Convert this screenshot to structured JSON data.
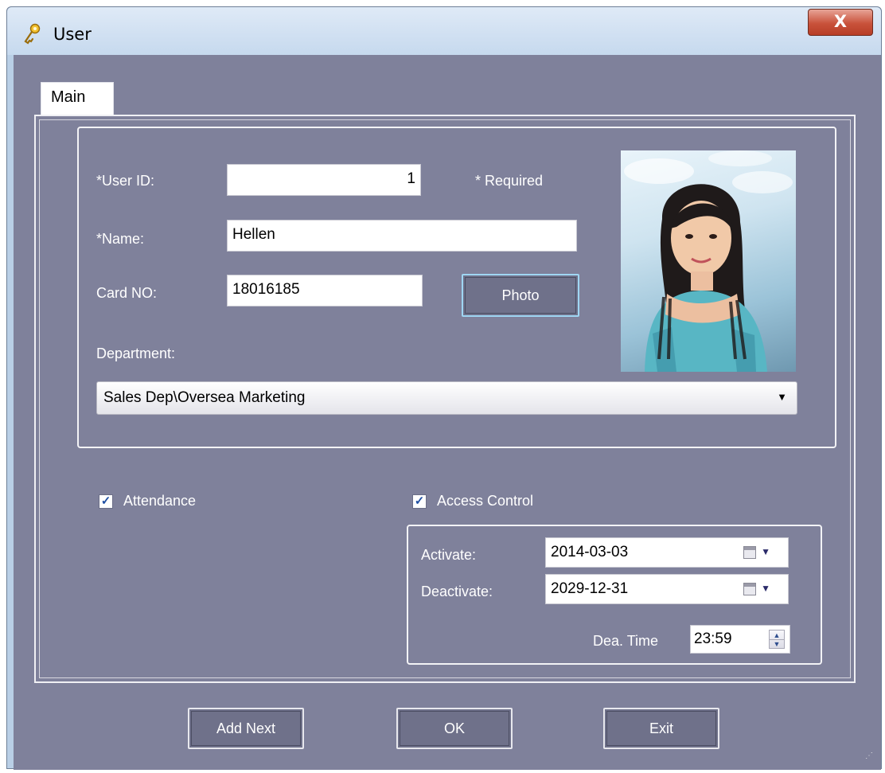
{
  "window": {
    "title": "User",
    "close_label": "X"
  },
  "tabs": [
    {
      "label": "Main"
    }
  ],
  "form": {
    "user_id_label": "*User ID:",
    "user_id_value": "1",
    "required_note": "* Required",
    "name_label": "*Name:",
    "name_value": "Hellen",
    "card_label": "Card NO:",
    "card_value": "18016185",
    "photo_button": "Photo",
    "department_label": "Department:",
    "department_value": "Sales Dep\\Oversea Marketing"
  },
  "options": {
    "attendance_label": "Attendance",
    "attendance_checked": true,
    "access_label": "Access Control",
    "access_checked": true,
    "check_glyph": "✓"
  },
  "access": {
    "activate_label": "Activate:",
    "activate_value": "2014-03-03",
    "deactivate_label": "Deactivate:",
    "deactivate_value": "2029-12-31",
    "dea_time_label": "Dea. Time",
    "dea_time_value": "23:59"
  },
  "buttons": {
    "add_next": "Add Next",
    "ok": "OK",
    "exit": "Exit"
  },
  "icons": {
    "app": "key-icon",
    "dropdown": "chevron-down-icon",
    "calendar": "calendar-icon",
    "spin_up": "▲",
    "spin_down": "▼",
    "dropdown_glyph": "▼"
  },
  "colors": {
    "client_background": "#7f819b",
    "title_bar": "#c6d9ee",
    "close_button": "#c9523b",
    "button_face": "#6f718a",
    "check_color": "#1f4fa3"
  }
}
